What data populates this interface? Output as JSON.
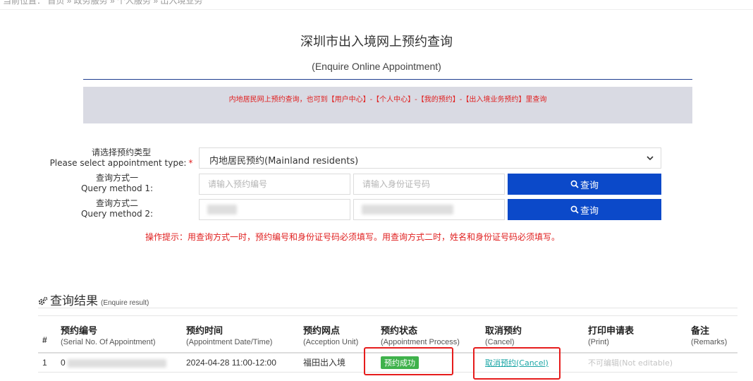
{
  "breadcrumb": {
    "text": "当前位置： 首页 » 政务服务 » 个人服务 » 出入境业务"
  },
  "page": {
    "title": "深圳市出入境网上预约查询",
    "subtitle": "(Enquire Online Appointment)"
  },
  "notice": {
    "text": "内地居民网上预约查询，也可到【用户中心】-【个人中心】-【我的预约】-【出入境业务预约】里查询"
  },
  "form": {
    "type_label_cn": "请选择预约类型",
    "type_label_en": "Please select appointment type:",
    "required_mark": "*",
    "type_value": "内地居民预约(Mainland residents)",
    "method1_label_cn": "查询方式一",
    "method1_label_en": "Query method 1:",
    "method1_placeholder_a": "请输入预约编号",
    "method1_placeholder_b": "请输入身份证号码",
    "method2_label_cn": "查询方式二",
    "method2_label_en": "Query method 2:",
    "search_label": "查询"
  },
  "hint": {
    "text": "操作提示：用查询方式一时，预约编号和身份证号码必须填写。用查询方式二时，姓名和身份证号码必须填写。"
  },
  "results": {
    "title": "查询结果",
    "subtitle": "(Enquire result)",
    "columns": [
      {
        "cn": "#",
        "en": ""
      },
      {
        "cn": "预约编号",
        "en": "(Serial No. Of Appointment)"
      },
      {
        "cn": "预约时间",
        "en": "(Appointment Date/Time)"
      },
      {
        "cn": "预约网点",
        "en": "(Acception Unit)"
      },
      {
        "cn": "预约状态",
        "en": "(Appointment Process)"
      },
      {
        "cn": "取消预约",
        "en": "(Cancel)"
      },
      {
        "cn": "打印申请表",
        "en": "(Print)"
      },
      {
        "cn": "备注",
        "en": "(Remarks)"
      }
    ],
    "rows": [
      {
        "index": "1",
        "serial_prefix": "0",
        "datetime": "2024-04-28 11:00-12:00",
        "unit": "福田出入境",
        "status": "预约成功",
        "cancel": "取消预约(Cancel)",
        "print": "不可编辑(Not editable)",
        "remarks": ""
      }
    ]
  },
  "colors": {
    "primary_button": "#0b49c9",
    "notice_red": "#e02020",
    "status_green": "#3fb24b",
    "cancel_link": "#1ba6a6",
    "highlight_red": "#e61c1c"
  }
}
